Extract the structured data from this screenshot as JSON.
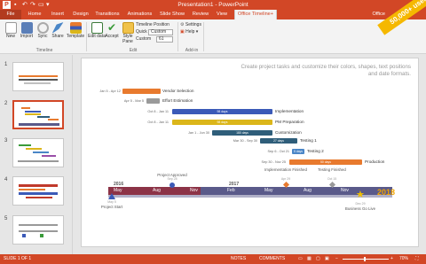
{
  "window": {
    "title": "Presentation1 - PowerPoint",
    "app_icon": "P"
  },
  "quick_access": [
    "save-icon",
    "undo-icon",
    "redo-icon",
    "slideshow-icon",
    "dropdown-icon"
  ],
  "tabs": [
    "File",
    "Home",
    "Insert",
    "Design",
    "Transitions",
    "Animations",
    "Slide Show",
    "Review",
    "View",
    "Office Timeline+"
  ],
  "active_tab": "Office Timeline+",
  "user": "Office",
  "promo": "50,000+ users",
  "ribbon": {
    "buttons": [
      {
        "label": "New",
        "icon": "new-icon"
      },
      {
        "label": "Import",
        "icon": "import-icon"
      },
      {
        "label": "Sync",
        "icon": "sync-icon"
      },
      {
        "label": "Share",
        "icon": "share-icon"
      },
      {
        "label": "Template",
        "icon": "template-icon"
      },
      {
        "label": "Edit data",
        "icon": "edit-data-icon"
      },
      {
        "label": "Accept",
        "icon": "accept-icon"
      },
      {
        "label": "Style Pane",
        "icon": "style-pane-icon"
      }
    ],
    "groups": [
      "Timeline",
      "Edit",
      "Add-in"
    ],
    "timeline_position_label": "Timeline Position",
    "quick_label": "Quick",
    "quick_value": "Custom",
    "custom_label": "Custom",
    "custom_value": "61",
    "settings_label": "Settings",
    "help_label": "Help"
  },
  "slides": [
    {
      "num": "1"
    },
    {
      "num": "2",
      "selected": true
    },
    {
      "num": "3"
    },
    {
      "num": "4"
    },
    {
      "num": "5"
    }
  ],
  "slide": {
    "header": "Create project tasks and customize their colors, shapes, text positions and date formats.",
    "tasks": [
      {
        "name": "Vendor Selection",
        "dates": "Jan 5 - Apr 12",
        "label": "",
        "color": "#e87a2e"
      },
      {
        "name": "Effort Estimation",
        "dates": "Apr 5 - Mar 5",
        "label": "",
        "color": "#9a9a9a"
      },
      {
        "name": "Implementation",
        "dates": "Oct 8 - Jan 11",
        "label": "98 days",
        "color": "#3b5ab8"
      },
      {
        "name": "PM Preparation",
        "dates": "Oct 8 - Jan 11",
        "label": "98 days",
        "color": "#dbb61a"
      },
      {
        "name": "Customization",
        "dates": "Jan 1 - Jun 30",
        "label": "180 days",
        "color": "#2f5e7a"
      },
      {
        "name": "Testing 1",
        "dates": "Mar 30 - Sep 30",
        "label": "27 days",
        "color": "#2f5e7a"
      },
      {
        "name": "Testing 2",
        "dates": "Sep 6 - Oct 21",
        "label": "5 days",
        "color": "#4a8fd4"
      },
      {
        "name": "Production",
        "dates": "Sep 30 - Nov 25",
        "label": "50 days",
        "color": "#e87a2e"
      }
    ],
    "years": [
      "2016",
      "2017"
    ],
    "year_end": "2018",
    "months": [
      "May",
      "Aug",
      "Nov",
      "Feb",
      "May",
      "Aug",
      "Nov"
    ],
    "milestones": [
      {
        "name": "Project Start",
        "date": "May 5",
        "icon": "flag-icon",
        "pos": "below"
      },
      {
        "name": "Project Approved",
        "date": "Sep 28",
        "icon": "circle-milestone-icon",
        "pos": "above"
      },
      {
        "name": "Implementation Finished",
        "date": "Apr 29",
        "icon": "diamond-milestone-icon",
        "pos": "above"
      },
      {
        "name": "Testing Finished",
        "date": "Oct 15",
        "icon": "diamond-milestone-icon",
        "pos": "above"
      },
      {
        "name": "Business Go Live",
        "date": "Dec 29",
        "icon": "star-milestone-icon",
        "pos": "below"
      }
    ]
  },
  "status": {
    "slide": "SLIDE 1 OF 1",
    "notes": "NOTES",
    "comments": "COMMENTS",
    "zoom": "70%"
  }
}
